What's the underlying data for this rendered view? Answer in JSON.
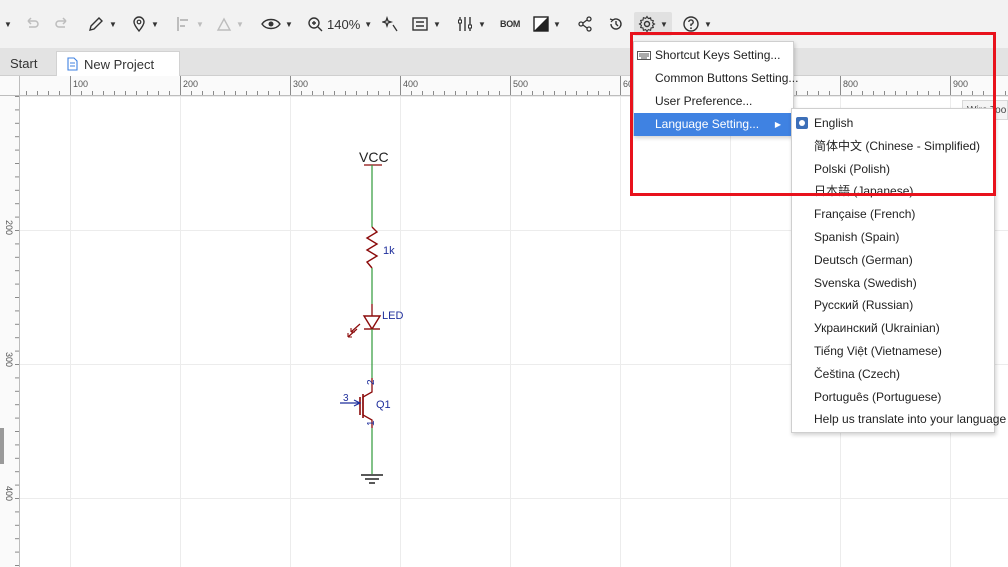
{
  "toolbar": {
    "zoom_level": "140%",
    "bom_label": "BOM",
    "icons": [
      "dropdown-caret",
      "undo-icon",
      "redo-icon",
      "pencil-icon",
      "location-pin-icon",
      "align-icon",
      "measure-icon",
      "eye-icon",
      "zoom-icon",
      "sparkle-icon",
      "component-icon",
      "tools-icon",
      "bom-icon",
      "contrast-icon",
      "share-icon",
      "history-icon",
      "gear-icon",
      "help-icon"
    ]
  },
  "tabs": {
    "start_label": "Start",
    "project_label": "New Project"
  },
  "ruler": {
    "top_labels": [
      "100",
      "200",
      "300",
      "400",
      "500",
      "600",
      "800",
      "900"
    ],
    "left_labels": [
      "200",
      "300",
      "400"
    ]
  },
  "schematic": {
    "vcc_label": "VCC",
    "resistor_label": "1k",
    "led_label": "LED",
    "transistor_label": "Q1",
    "pin_3": "3",
    "pin_2": "2",
    "pin_1": "1"
  },
  "settings_menu": {
    "items": [
      {
        "label": "Shortcut Keys Setting..."
      },
      {
        "label": "Common Buttons Setting..."
      },
      {
        "label": "User Preference..."
      },
      {
        "label": "Language Setting..."
      }
    ]
  },
  "language_menu": {
    "items": [
      {
        "label": "English",
        "selected": true
      },
      {
        "label": "简体中文 (Chinese - Simplified)"
      },
      {
        "label": "Polski (Polish)"
      },
      {
        "label": "日本語 (Japanese)"
      },
      {
        "label": "Française (French)"
      },
      {
        "label": "Spanish (Spain)"
      },
      {
        "label": "Deutsch (German)"
      },
      {
        "label": "Svenska (Swedish)"
      },
      {
        "label": "Русский (Russian)"
      },
      {
        "label": "Украинский (Ukrainian)"
      },
      {
        "label": "Tiếng Việt (Vietnamese)"
      },
      {
        "label": "Čeština (Czech)"
      },
      {
        "label": "Português (Portuguese)"
      },
      {
        "label": "Help us translate into your language"
      }
    ]
  },
  "side_panel": {
    "fragment_label": "Wire Too"
  },
  "colors": {
    "highlight": "#e8121c",
    "menu_active": "#3f82e2",
    "wire": "#2e9a3a",
    "component": "#8b0a0a",
    "pin_number": "#1f2f9c"
  }
}
